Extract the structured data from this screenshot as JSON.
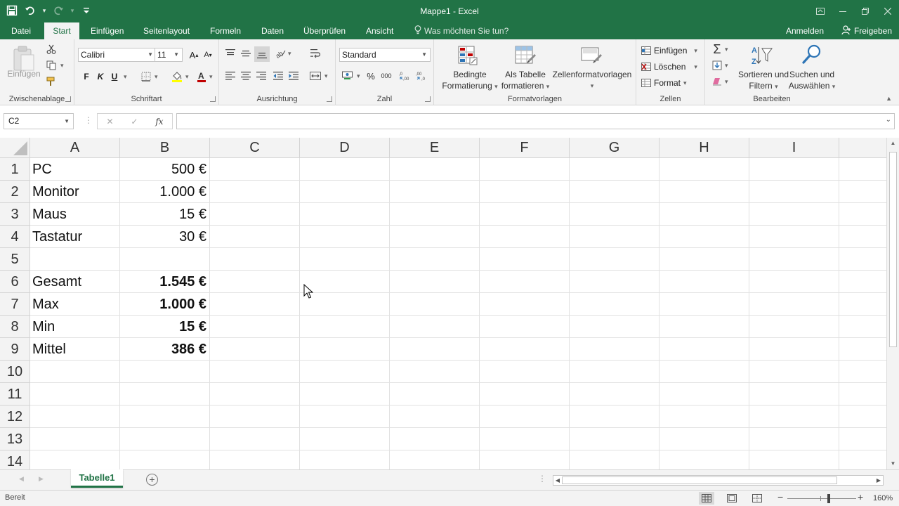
{
  "window": {
    "title": "Mappe1 - Excel",
    "accent": "#217346"
  },
  "menu": {
    "tabs": [
      "Datei",
      "Start",
      "Einfügen",
      "Seitenlayout",
      "Formeln",
      "Daten",
      "Überprüfen",
      "Ansicht"
    ],
    "active_tab": "Start",
    "tell_me": "Was möchten Sie tun?",
    "signin": "Anmelden",
    "share": "Freigeben"
  },
  "ribbon": {
    "clipboard": {
      "label": "Zwischenablage",
      "paste": "Einfügen"
    },
    "font": {
      "label": "Schriftart",
      "name": "Calibri",
      "size": "11",
      "bold": "F",
      "italic": "K",
      "underline": "U"
    },
    "alignment": {
      "label": "Ausrichtung"
    },
    "number": {
      "label": "Zahl",
      "format": "Standard",
      "percent": "%",
      "thousands": "000"
    },
    "styles": {
      "label": "Formatvorlagen",
      "conditional_1": "Bedingte",
      "conditional_2": "Formatierung",
      "table_1": "Als Tabelle",
      "table_2": "formatieren",
      "cell_styles": "Zellenformatvorlagen"
    },
    "cells": {
      "label": "Zellen",
      "insert": "Einfügen",
      "delete": "Löschen",
      "format": "Format"
    },
    "editing": {
      "label": "Bearbeiten",
      "sort_1": "Sortieren und",
      "sort_2": "Filtern",
      "find_1": "Suchen und",
      "find_2": "Auswählen"
    }
  },
  "formula_bar": {
    "name_box": "C2",
    "fx": "fx",
    "content": ""
  },
  "sheet": {
    "columns": [
      "A",
      "B",
      "C",
      "D",
      "E",
      "F",
      "G",
      "H",
      "I"
    ],
    "rows": [
      {
        "n": "1",
        "a": "PC",
        "b": "500 €",
        "bold": false
      },
      {
        "n": "2",
        "a": "Monitor",
        "b": "1.000 €",
        "bold": false
      },
      {
        "n": "3",
        "a": "Maus",
        "b": "15 €",
        "bold": false
      },
      {
        "n": "4",
        "a": "Tastatur",
        "b": "30 €",
        "bold": false
      },
      {
        "n": "5",
        "a": "",
        "b": "",
        "bold": false
      },
      {
        "n": "6",
        "a": "Gesamt",
        "b": "1.545 €",
        "bold": true
      },
      {
        "n": "7",
        "a": "Max",
        "b": "1.000 €",
        "bold": true
      },
      {
        "n": "8",
        "a": "Min",
        "b": "15 €",
        "bold": true
      },
      {
        "n": "9",
        "a": "Mittel",
        "b": "386 €",
        "bold": true
      },
      {
        "n": "10",
        "a": "",
        "b": "",
        "bold": false
      },
      {
        "n": "11",
        "a": "",
        "b": "",
        "bold": false
      },
      {
        "n": "12",
        "a": "",
        "b": "",
        "bold": false
      },
      {
        "n": "13",
        "a": "",
        "b": "",
        "bold": false
      },
      {
        "n": "14",
        "a": "",
        "b": "",
        "bold": false
      }
    ],
    "tab": "Tabelle1"
  },
  "status": {
    "ready": "Bereit",
    "zoom": "160%",
    "zoom_level": 160
  }
}
